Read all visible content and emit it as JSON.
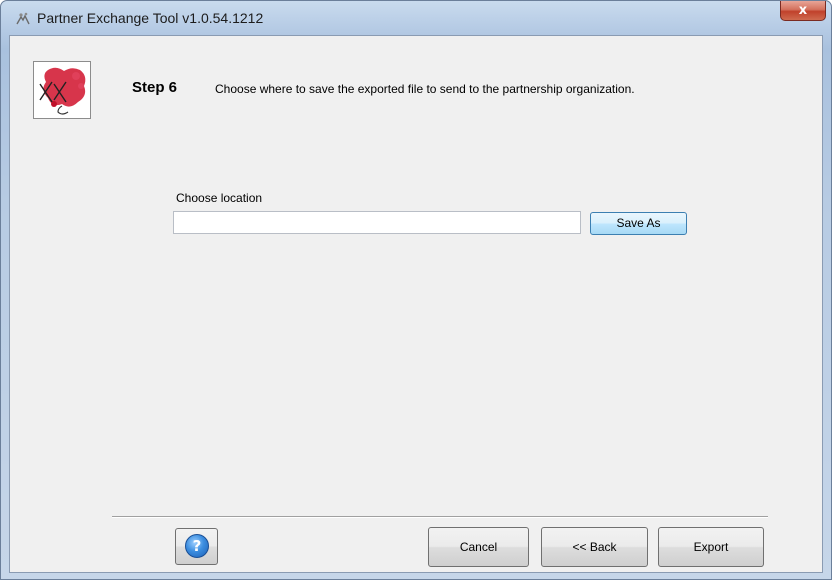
{
  "window": {
    "title": "Partner Exchange Tool v1.0.54.1212",
    "close_symbol": "x",
    "app_icon": "app-icon",
    "close_icon": "close-icon"
  },
  "header": {
    "logo": "logo-image",
    "step_title": "Step 6",
    "step_description": "Choose where to save the exported file to send to the partnership organization."
  },
  "location": {
    "label": "Choose location",
    "value": "",
    "save_as_label": "Save As"
  },
  "footer": {
    "help_icon": "help-icon",
    "help_symbol": "?",
    "cancel_label": "Cancel",
    "back_label": "<< Back",
    "export_label": "Export"
  },
  "colors": {
    "titlebar": "#b8cde6",
    "client_background": "#f0f0f0",
    "close_button": "#c0412b",
    "focus_button": "#3c7fb1",
    "logo_red": "#d0122c"
  }
}
